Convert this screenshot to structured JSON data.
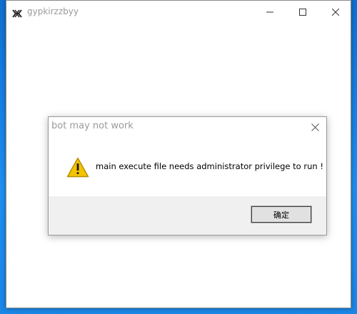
{
  "window": {
    "title": "gypkirzzbyy",
    "icons": {
      "app": "app-logo-icon",
      "minimize": "minimize-icon",
      "maximize": "maximize-icon",
      "close": "close-icon"
    }
  },
  "dialog": {
    "title": "bot may not work",
    "message": "main execute file needs administrator privilege to run !",
    "ok_label": "确定",
    "icons": {
      "warning": "warning-icon",
      "close": "close-icon"
    },
    "colors": {
      "warning_fill": "#f5c400",
      "warning_stroke": "#b58d00",
      "footer_bg": "#f0f0f0"
    }
  },
  "desktop": {
    "accent": "#1e8ff0"
  }
}
